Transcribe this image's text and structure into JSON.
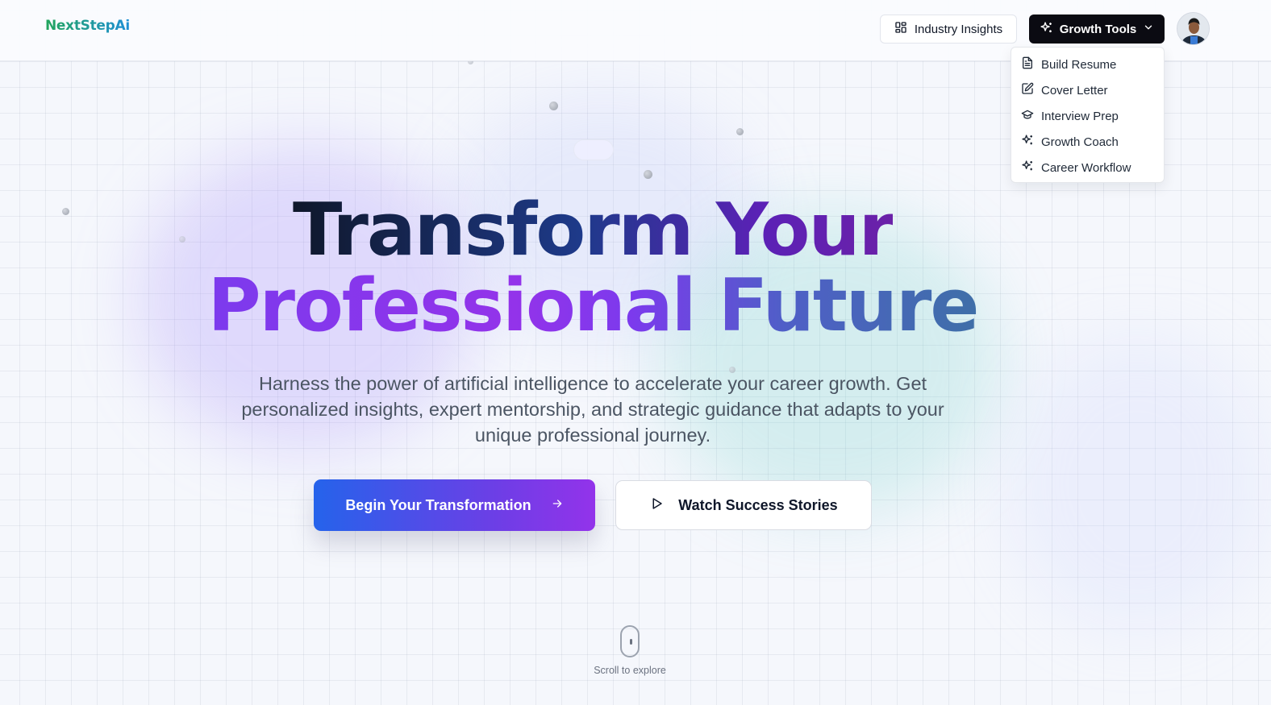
{
  "brand": {
    "name": "NextStepAi"
  },
  "nav": {
    "insights_label": "Industry Insights",
    "growth_label": "Growth Tools"
  },
  "dropdown": {
    "items": [
      {
        "label": "Build Resume",
        "icon": "file-text-icon"
      },
      {
        "label": "Cover Letter",
        "icon": "pen-square-icon"
      },
      {
        "label": "Interview Prep",
        "icon": "graduation-cap-icon"
      },
      {
        "label": "Growth Coach",
        "icon": "sparkles-icon"
      },
      {
        "label": "Career Workflow",
        "icon": "sparkles-icon"
      }
    ]
  },
  "hero": {
    "title_line1": "Transform Your",
    "title_line2": "Professional Future",
    "subtitle": "Harness the power of artificial intelligence to accelerate your career growth. Get personalized insights, expert mentorship, and strategic guidance that adapts to your unique professional journey.",
    "primary_cta": "Begin Your Transformation",
    "secondary_cta": "Watch Success Stories",
    "scroll_hint": "Scroll to explore"
  },
  "colors": {
    "accent_blue": "#2563eb",
    "accent_purple": "#9333ea",
    "dark_button": "#0b0b12",
    "logo_green": "#22a55b",
    "logo_blue": "#1f8fd6"
  }
}
